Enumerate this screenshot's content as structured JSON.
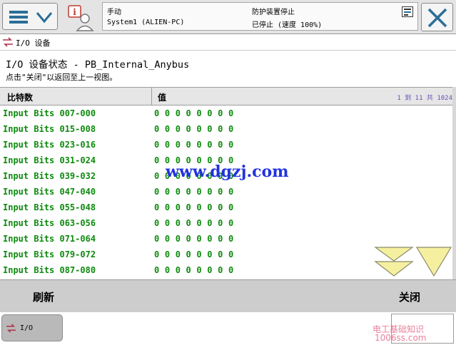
{
  "header": {
    "mode": "手动",
    "system": "System1 (ALIEN-PC)",
    "safety_status": "防护装置停止",
    "run_status": "已停止 (速度 100%)"
  },
  "tab": {
    "label": "I/O 设备"
  },
  "page": {
    "heading": "I/O 设备状态 - PB_Internal_Anybus",
    "hint": "点击\"关闭\"以返回至上一视图。"
  },
  "table": {
    "col_name": "比特数",
    "col_value": "值",
    "range": "1 到 11 共 1024",
    "rows": [
      {
        "name": "Input Bits 007-000",
        "value": "0 0 0 0 0 0 0 0"
      },
      {
        "name": "Input Bits 015-008",
        "value": "0 0 0 0 0 0 0 0"
      },
      {
        "name": "Input Bits 023-016",
        "value": "0 0 0 0 0 0 0 0"
      },
      {
        "name": "Input Bits 031-024",
        "value": "0 0 0 0 0 0 0 0"
      },
      {
        "name": "Input Bits 039-032",
        "value": "0 0 0 0 0 0 0 0"
      },
      {
        "name": "Input Bits 047-040",
        "value": "0 0 0 0 0 0 0 0"
      },
      {
        "name": "Input Bits 055-048",
        "value": "0 0 0 0 0 0 0 0"
      },
      {
        "name": "Input Bits 063-056",
        "value": "0 0 0 0 0 0 0 0"
      },
      {
        "name": "Input Bits 071-064",
        "value": "0 0 0 0 0 0 0 0"
      },
      {
        "name": "Input Bits 079-072",
        "value": "0 0 0 0 0 0 0 0"
      },
      {
        "name": "Input Bits 087-080",
        "value": "0 0 0 0 0 0 0 0"
      }
    ]
  },
  "watermark": "www.dgzj.com",
  "buttons": {
    "refresh": "刷新",
    "close": "关闭"
  },
  "taskbar": {
    "io_label": "I/O"
  },
  "brand": {
    "line1": "电工基础知识",
    "line2": "1006ss.com"
  },
  "colors": {
    "value_green": "#0e8a0e",
    "watermark_blue": "#2233dd",
    "scroll_arrow_yellow": "#f5f0a0"
  },
  "icons": [
    "menu-icon",
    "chevron-down-icon",
    "operator-info-icon",
    "status-indicator-icon",
    "close-x-icon",
    "io-icon",
    "page-down-icon",
    "scroll-down-icon"
  ]
}
